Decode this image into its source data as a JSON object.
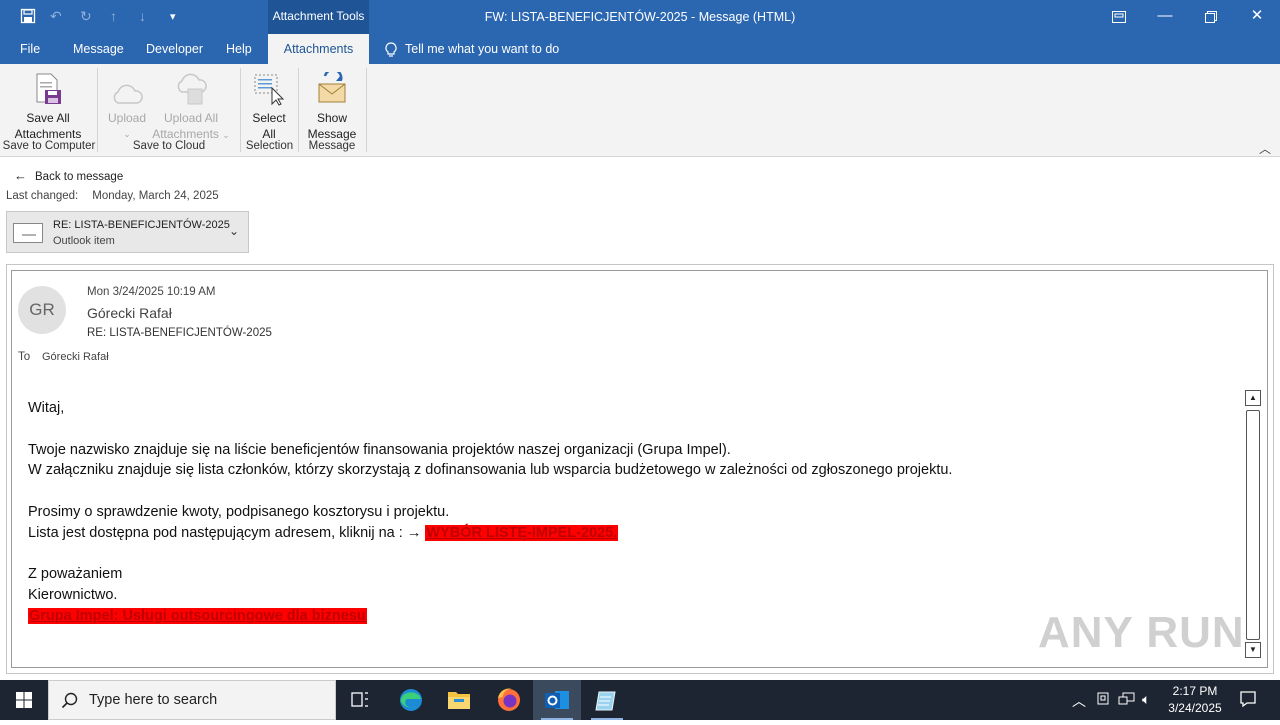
{
  "window": {
    "context_tools_label": "Attachment Tools",
    "title": "FW: LISTA-BENEFICJENTÓW-2025  -  Message (HTML)"
  },
  "tabs": [
    {
      "label": "File"
    },
    {
      "label": "Message"
    },
    {
      "label": "Developer"
    },
    {
      "label": "Help"
    },
    {
      "label": "Attachments",
      "active": true
    }
  ],
  "tell_me": "Tell me what you want to do",
  "ribbon": {
    "save_all_line1": "Save All",
    "save_all_line2": "Attachments",
    "group_save_to_computer": "Save to Computer",
    "upload_label": "Upload",
    "upload_all_line1": "Upload All",
    "upload_all_line2": "Attachments",
    "group_save_to_cloud": "Save to Cloud",
    "select_all_line1": "Select",
    "select_all_line2": "All",
    "group_selection": "Selection",
    "show_message_line1": "Show",
    "show_message_line2": "Message",
    "group_message": "Message"
  },
  "attachment_view": {
    "back_label": "Back to message",
    "last_changed_label": "Last changed:",
    "last_changed_value": "Monday, March 24, 2025",
    "item_title": "RE: LISTA-BENEFICJENTÓW-2025",
    "item_type": "Outlook item"
  },
  "message": {
    "avatar_initials": "GR",
    "date": "Mon 3/24/2025 10:19 AM",
    "sender": "Górecki Rafał",
    "subject": "RE: LISTA-BENEFICJENTÓW-2025",
    "to_label": "To",
    "to_value": "Górecki Rafał",
    "greeting": "Witaj,",
    "line1": "Twoje nazwisko znajduje się na liście beneficjentów finansowania projektów naszej organizacji (Grupa Impel).",
    "line2": "W załączniku znajduje się lista członków, którzy skorzystają z dofinansowania lub wsparcia budżetowego w zależności od zgłoszonego projektu.",
    "line3": "Prosimy o sprawdzenie kwoty, podpisanego kosztorysu i projektu.",
    "line4_prefix": "Lista jest dostępna pod następującym adresem, kliknij na : → ",
    "link1": "WYBÓR LISTĘ-IMPEL-2025.",
    "closing1": "Z poważaniem",
    "closing2": "Kierownictwo.",
    "link2": "Grupa Impel: Usługi outsourcingowe dla biznesu"
  },
  "watermark": "ANY RUN",
  "taskbar": {
    "search_placeholder": "Type here to search",
    "time": "2:17 PM",
    "date": "3/24/2025"
  },
  "colors": {
    "title_bar": "#2b66b1",
    "link_highlight": "#ff0000",
    "taskbar": "#1c2531"
  }
}
